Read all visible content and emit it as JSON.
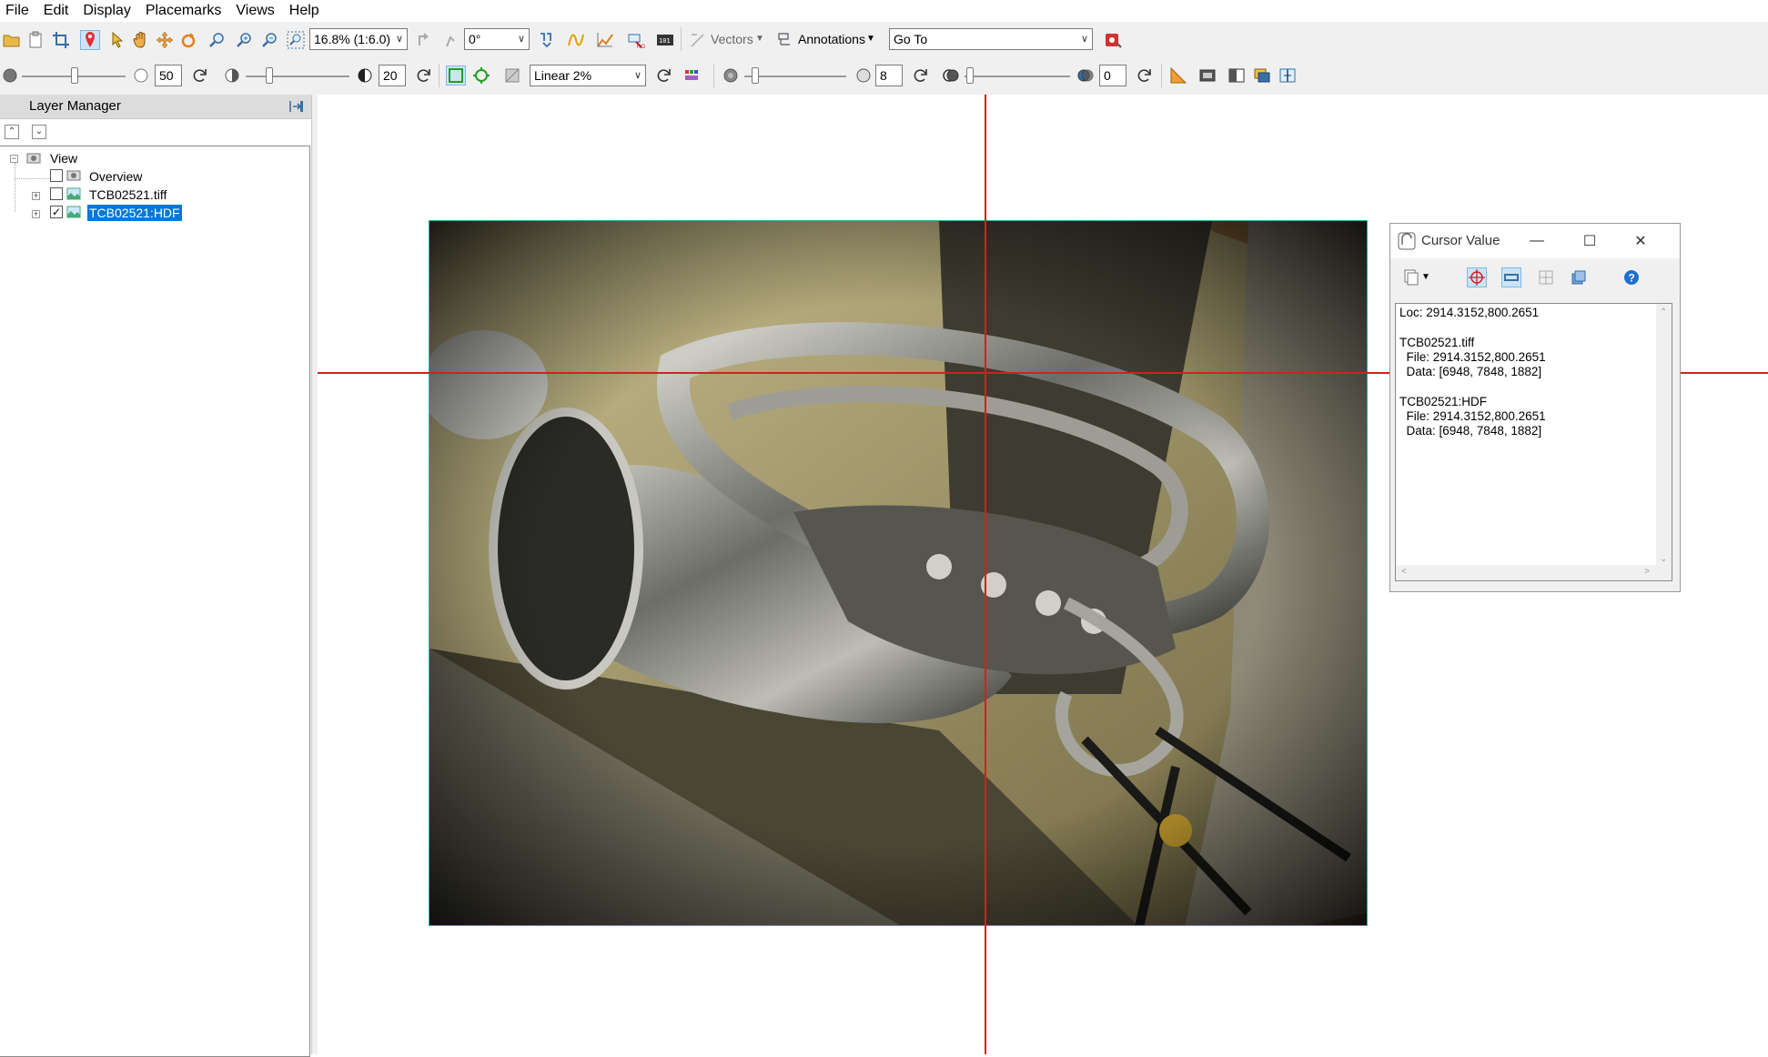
{
  "menu": [
    "File",
    "Edit",
    "Display",
    "Placemarks",
    "Views",
    "Help"
  ],
  "toolbar1": {
    "zoom": "16.8% (1:6.0)",
    "rotation": "0°",
    "vectors_label": "Vectors",
    "annotations_label": "Annotations",
    "goto": "Go To"
  },
  "toolbar2": {
    "brightness": "50",
    "contrast": "20",
    "stretch": "Linear 2%",
    "sharpen": "8",
    "transparency": "0"
  },
  "layer_manager": {
    "title": "Layer Manager",
    "root": "View",
    "items": [
      {
        "label": "Overview",
        "checked": false
      },
      {
        "label": "TCB02521.tiff",
        "checked": false
      },
      {
        "label": "TCB02521:HDF",
        "checked": true,
        "selected": true
      }
    ]
  },
  "cursor_value": {
    "title": "Cursor Value",
    "lines": [
      "Loc: 2914.3152,800.2651",
      "",
      "TCB02521.tiff",
      "  File: 2914.3152,800.2651",
      "  Data: [6948, 7848, 1882]",
      "",
      "TCB02521:HDF",
      "  File: 2914.3152,800.2651",
      "  Data: [6948, 7848, 1882]"
    ]
  },
  "colors": {
    "crosshair": "#d42020",
    "image_border": "#20b2aa",
    "selection": "#0078d7"
  }
}
